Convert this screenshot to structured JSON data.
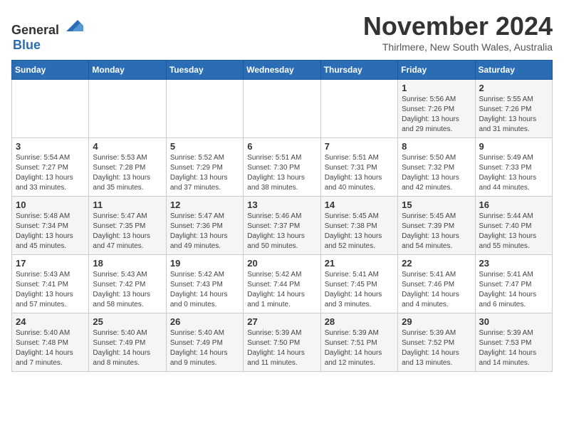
{
  "header": {
    "logo_general": "General",
    "logo_blue": "Blue",
    "month": "November 2024",
    "location": "Thirlmere, New South Wales, Australia"
  },
  "weekdays": [
    "Sunday",
    "Monday",
    "Tuesday",
    "Wednesday",
    "Thursday",
    "Friday",
    "Saturday"
  ],
  "weeks": [
    [
      {
        "day": "",
        "info": ""
      },
      {
        "day": "",
        "info": ""
      },
      {
        "day": "",
        "info": ""
      },
      {
        "day": "",
        "info": ""
      },
      {
        "day": "",
        "info": ""
      },
      {
        "day": "1",
        "info": "Sunrise: 5:56 AM\nSunset: 7:26 PM\nDaylight: 13 hours and 29 minutes."
      },
      {
        "day": "2",
        "info": "Sunrise: 5:55 AM\nSunset: 7:26 PM\nDaylight: 13 hours and 31 minutes."
      }
    ],
    [
      {
        "day": "3",
        "info": "Sunrise: 5:54 AM\nSunset: 7:27 PM\nDaylight: 13 hours and 33 minutes."
      },
      {
        "day": "4",
        "info": "Sunrise: 5:53 AM\nSunset: 7:28 PM\nDaylight: 13 hours and 35 minutes."
      },
      {
        "day": "5",
        "info": "Sunrise: 5:52 AM\nSunset: 7:29 PM\nDaylight: 13 hours and 37 minutes."
      },
      {
        "day": "6",
        "info": "Sunrise: 5:51 AM\nSunset: 7:30 PM\nDaylight: 13 hours and 38 minutes."
      },
      {
        "day": "7",
        "info": "Sunrise: 5:51 AM\nSunset: 7:31 PM\nDaylight: 13 hours and 40 minutes."
      },
      {
        "day": "8",
        "info": "Sunrise: 5:50 AM\nSunset: 7:32 PM\nDaylight: 13 hours and 42 minutes."
      },
      {
        "day": "9",
        "info": "Sunrise: 5:49 AM\nSunset: 7:33 PM\nDaylight: 13 hours and 44 minutes."
      }
    ],
    [
      {
        "day": "10",
        "info": "Sunrise: 5:48 AM\nSunset: 7:34 PM\nDaylight: 13 hours and 45 minutes."
      },
      {
        "day": "11",
        "info": "Sunrise: 5:47 AM\nSunset: 7:35 PM\nDaylight: 13 hours and 47 minutes."
      },
      {
        "day": "12",
        "info": "Sunrise: 5:47 AM\nSunset: 7:36 PM\nDaylight: 13 hours and 49 minutes."
      },
      {
        "day": "13",
        "info": "Sunrise: 5:46 AM\nSunset: 7:37 PM\nDaylight: 13 hours and 50 minutes."
      },
      {
        "day": "14",
        "info": "Sunrise: 5:45 AM\nSunset: 7:38 PM\nDaylight: 13 hours and 52 minutes."
      },
      {
        "day": "15",
        "info": "Sunrise: 5:45 AM\nSunset: 7:39 PM\nDaylight: 13 hours and 54 minutes."
      },
      {
        "day": "16",
        "info": "Sunrise: 5:44 AM\nSunset: 7:40 PM\nDaylight: 13 hours and 55 minutes."
      }
    ],
    [
      {
        "day": "17",
        "info": "Sunrise: 5:43 AM\nSunset: 7:41 PM\nDaylight: 13 hours and 57 minutes."
      },
      {
        "day": "18",
        "info": "Sunrise: 5:43 AM\nSunset: 7:42 PM\nDaylight: 13 hours and 58 minutes."
      },
      {
        "day": "19",
        "info": "Sunrise: 5:42 AM\nSunset: 7:43 PM\nDaylight: 14 hours and 0 minutes."
      },
      {
        "day": "20",
        "info": "Sunrise: 5:42 AM\nSunset: 7:44 PM\nDaylight: 14 hours and 1 minute."
      },
      {
        "day": "21",
        "info": "Sunrise: 5:41 AM\nSunset: 7:45 PM\nDaylight: 14 hours and 3 minutes."
      },
      {
        "day": "22",
        "info": "Sunrise: 5:41 AM\nSunset: 7:46 PM\nDaylight: 14 hours and 4 minutes."
      },
      {
        "day": "23",
        "info": "Sunrise: 5:41 AM\nSunset: 7:47 PM\nDaylight: 14 hours and 6 minutes."
      }
    ],
    [
      {
        "day": "24",
        "info": "Sunrise: 5:40 AM\nSunset: 7:48 PM\nDaylight: 14 hours and 7 minutes."
      },
      {
        "day": "25",
        "info": "Sunrise: 5:40 AM\nSunset: 7:49 PM\nDaylight: 14 hours and 8 minutes."
      },
      {
        "day": "26",
        "info": "Sunrise: 5:40 AM\nSunset: 7:49 PM\nDaylight: 14 hours and 9 minutes."
      },
      {
        "day": "27",
        "info": "Sunrise: 5:39 AM\nSunset: 7:50 PM\nDaylight: 14 hours and 11 minutes."
      },
      {
        "day": "28",
        "info": "Sunrise: 5:39 AM\nSunset: 7:51 PM\nDaylight: 14 hours and 12 minutes."
      },
      {
        "day": "29",
        "info": "Sunrise: 5:39 AM\nSunset: 7:52 PM\nDaylight: 14 hours and 13 minutes."
      },
      {
        "day": "30",
        "info": "Sunrise: 5:39 AM\nSunset: 7:53 PM\nDaylight: 14 hours and 14 minutes."
      }
    ]
  ]
}
